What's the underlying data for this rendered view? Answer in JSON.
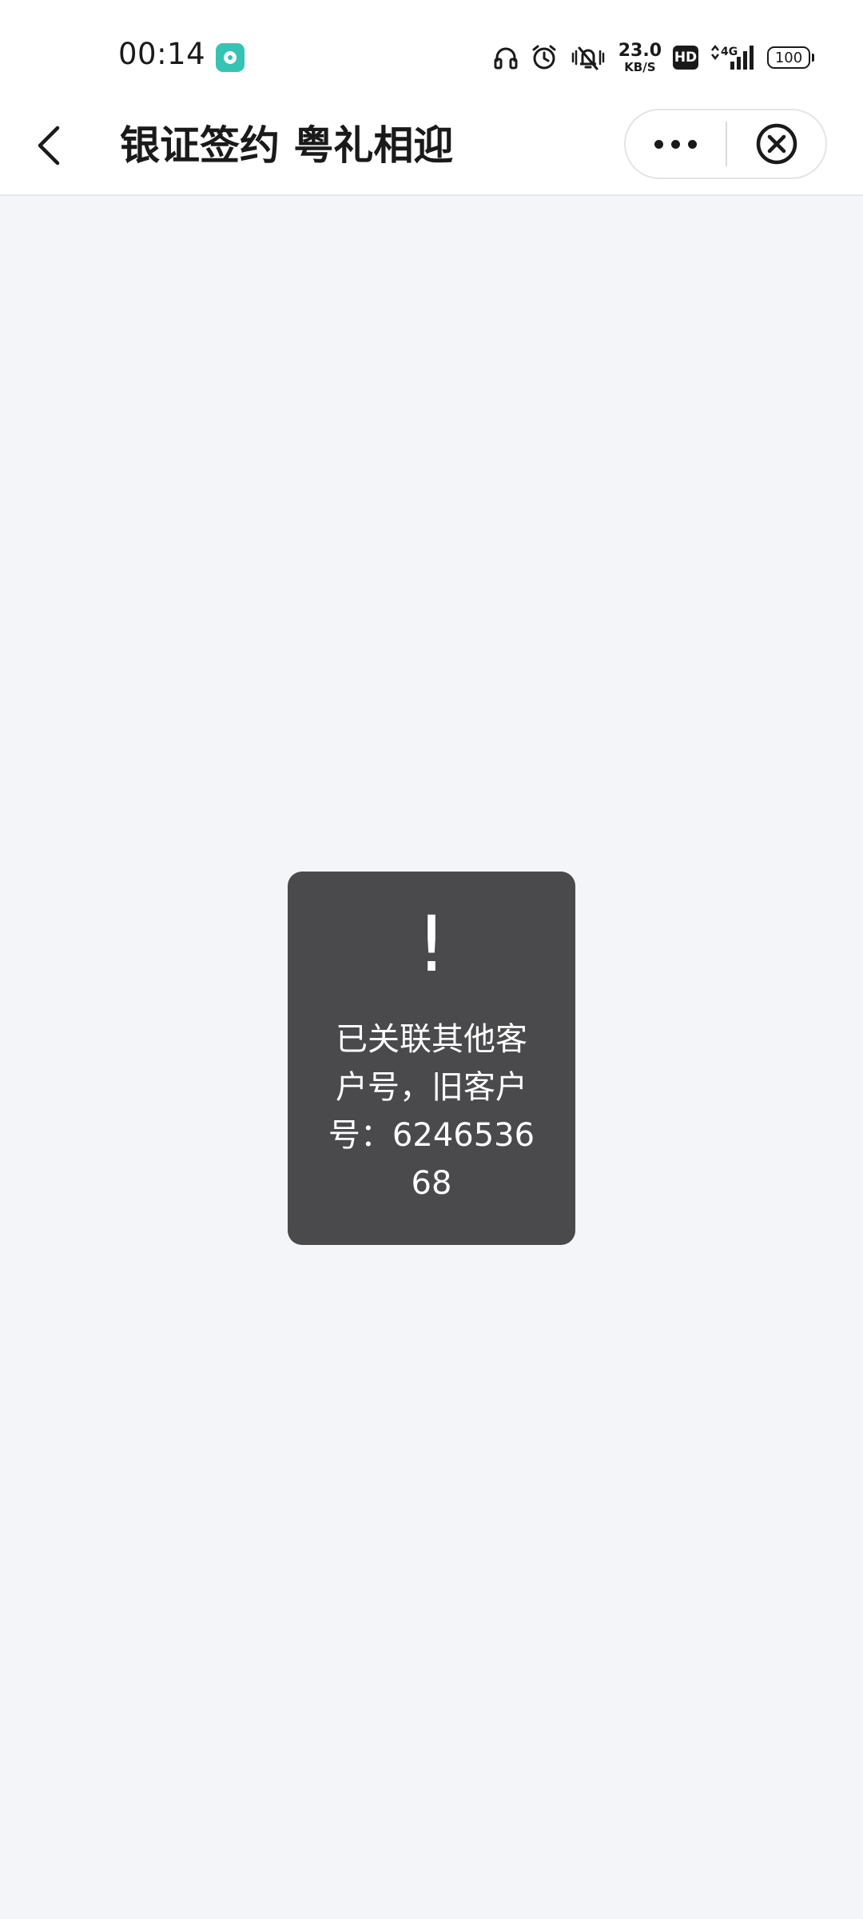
{
  "status_bar": {
    "time": "00:14",
    "net_speed_value": "23.0",
    "net_speed_unit": "KB/S",
    "hd_label": "HD",
    "network_type": "4G",
    "battery_level": "100",
    "notification_app_icon": "app-notification-icon",
    "icons": [
      "headphones-icon",
      "alarm-icon",
      "vibrate-silent-icon",
      "hd-icon",
      "signal-icon",
      "battery-icon"
    ]
  },
  "nav": {
    "title": "银证签约 粤礼相迎",
    "back_icon": "chevron-left-icon",
    "more_icon": "more-dots-icon",
    "close_icon": "close-circle-icon"
  },
  "toast": {
    "icon_glyph": "!",
    "message": "已关联其他客户号，旧客户号：624653668"
  },
  "colors": {
    "page_background": "#f4f5f9",
    "nav_background": "#ffffff",
    "toast_background": "#4a4a4c",
    "notif_icon": "#35c3b4"
  }
}
